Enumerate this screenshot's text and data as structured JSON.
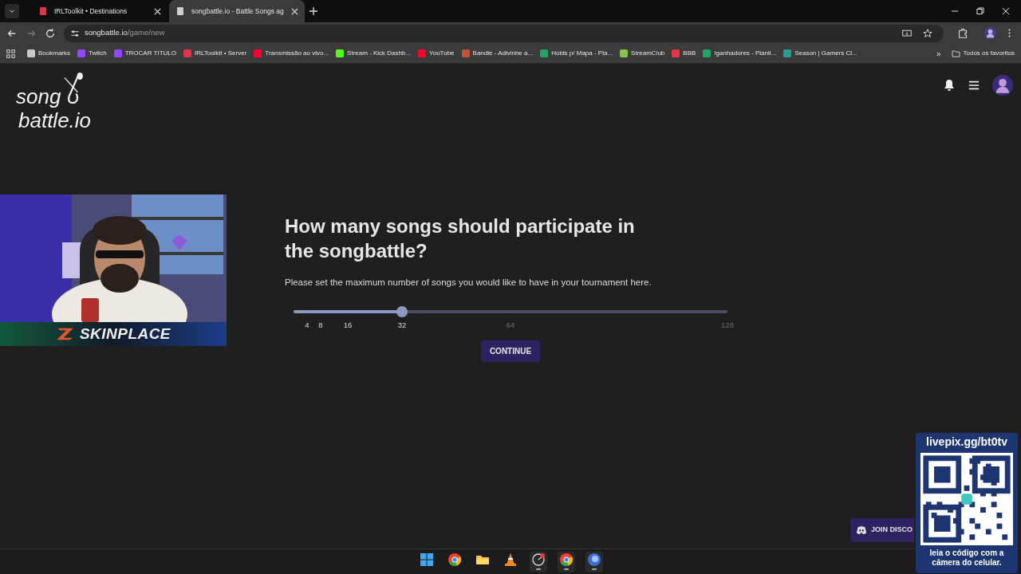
{
  "browser": {
    "tabs": [
      {
        "title": "IRLToolkit • Destinations",
        "selected": false,
        "color": "#e0344a"
      },
      {
        "title": "songbattle.io - Battle Songs ag",
        "selected": true,
        "color": "#d0d0d0"
      }
    ],
    "url_host": "songbattle.io",
    "url_path": "/game/new",
    "bookmarks": [
      {
        "label": "Bookmarks",
        "color": "#c8c8c8"
      },
      {
        "label": "Twitch",
        "color": "#9146ff"
      },
      {
        "label": "TROCAR TITULO",
        "color": "#9146ff"
      },
      {
        "label": "IRLToolkit • Server",
        "color": "#e0344a"
      },
      {
        "label": "Transmissão ao vivo...",
        "color": "#ff0033"
      },
      {
        "label": "Stream - Kick Dashb...",
        "color": "#53fc18"
      },
      {
        "label": "YouTube",
        "color": "#ff0033"
      },
      {
        "label": "Bandle - Adivinhe a...",
        "color": "#c0503a"
      },
      {
        "label": "Holds p/ Mapa - Pla...",
        "color": "#23a566"
      },
      {
        "label": "StreamClub",
        "color": "#8bc34a"
      },
      {
        "label": "BBB",
        "color": "#e8334a"
      },
      {
        "label": "!ganhadores - Planil...",
        "color": "#23a566"
      },
      {
        "label": "Season | Gamers Cl...",
        "color": "#2a9d8f"
      }
    ],
    "more_bookmarks": "»",
    "other_bookmarks": "Todos os favoritos"
  },
  "page": {
    "logo_top": "song",
    "logo_bottom": "battle.io",
    "overlay_brand": "SKINPLACE",
    "question": "How many songs should participate in the songbattle?",
    "description": "Please set the maximum number of songs you would like to have in your tournament here.",
    "slider": {
      "level": 0.25,
      "ticks": [
        "4",
        "8",
        "16",
        "32",
        "64",
        "128"
      ]
    },
    "continue_button": "CONTINUE",
    "discord_button": "JOIN DISCO",
    "qr_overlay": {
      "title": "livepix.gg/bt0tv",
      "caption": "leia o código com a câmera do celular."
    }
  },
  "taskbar": [
    {
      "kind": "windows",
      "running": false
    },
    {
      "kind": "chrome",
      "running": false
    },
    {
      "kind": "folder",
      "running": false
    },
    {
      "kind": "cone",
      "running": false
    },
    {
      "kind": "gauge",
      "running": true
    },
    {
      "kind": "chrome",
      "running": true
    },
    {
      "kind": "orb",
      "running": true
    }
  ]
}
